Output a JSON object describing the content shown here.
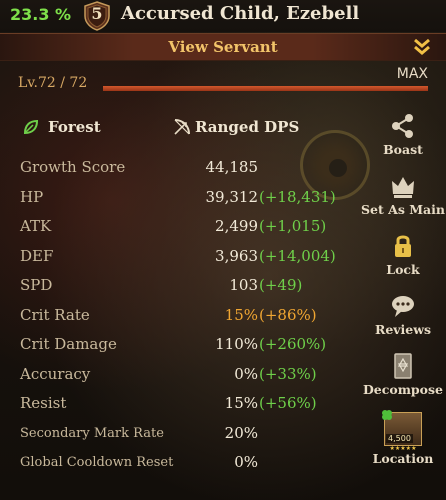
{
  "header": {
    "progress_percent": "23.3 %",
    "rank_number": "5",
    "servant_name": "Accursed Child, Ezebell"
  },
  "view_bar": {
    "label": "View Servant",
    "icon": "double-chevron-down-icon"
  },
  "level": {
    "label": "Lv.72 / 72",
    "current": 72,
    "max": 72,
    "fill_fraction": 1.0,
    "max_badge": "MAX"
  },
  "class_info": {
    "attribute_icon": "leaf-icon",
    "attribute": "Forest",
    "role_icon": "bow-icon",
    "role": "Ranged DPS"
  },
  "stats": [
    {
      "name": "Growth Score",
      "value": "44,185",
      "bonus": ""
    },
    {
      "name": "HP",
      "value": "39,312",
      "bonus": "(+18,431)"
    },
    {
      "name": "ATK",
      "value": "2,499",
      "bonus": "(+1,015)"
    },
    {
      "name": "DEF",
      "value": "3,963",
      "bonus": "(+14,004)"
    },
    {
      "name": "SPD",
      "value": "103",
      "bonus": "(+49)"
    },
    {
      "name": "Crit Rate",
      "value": "15%",
      "bonus": "(+86%)"
    },
    {
      "name": "Crit Damage",
      "value": "110%",
      "bonus": "(+260%)"
    },
    {
      "name": "Accuracy",
      "value": "0%",
      "bonus": "(+33%)"
    },
    {
      "name": "Resist",
      "value": "15%",
      "bonus": "(+56%)"
    },
    {
      "name": "Secondary Mark Rate",
      "value": "20%",
      "bonus": ""
    },
    {
      "name": "Global Cooldown Reset",
      "value": "0%",
      "bonus": ""
    }
  ],
  "side_menu": [
    {
      "label": "Boast",
      "icon": "share-icon"
    },
    {
      "label": "Set As Main",
      "icon": "crown-icon"
    },
    {
      "label": "Lock",
      "icon": "lock-icon"
    },
    {
      "label": "Reviews",
      "icon": "chat-bubble-icon"
    },
    {
      "label": "Decompose",
      "icon": "decompose-icon"
    },
    {
      "label": "Location",
      "icon": "location-card-icon",
      "card_value": "4,500",
      "card_stars": "★★★★★"
    }
  ],
  "colors": {
    "progress_green": "#7ee04a",
    "bonus_green": "#6fd04a",
    "highlight_orange": "#f0a632",
    "accent_gold": "#f2c46a",
    "bar_red": "#d2582d"
  }
}
